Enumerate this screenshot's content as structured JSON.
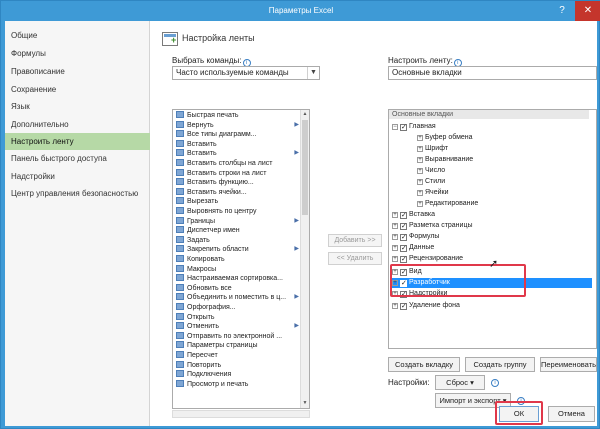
{
  "window": {
    "title": "Параметры Excel",
    "help_glyph": "?",
    "close_glyph": "✕"
  },
  "nav": {
    "items": [
      {
        "label": "Общие"
      },
      {
        "label": "Формулы"
      },
      {
        "label": "Правописание"
      },
      {
        "label": "Сохранение"
      },
      {
        "label": "Язык"
      },
      {
        "label": "Дополнительно"
      },
      {
        "label": "Настроить ленту",
        "active": true
      },
      {
        "label": "Панель быстрого доступа"
      },
      {
        "label": "Надстройки"
      },
      {
        "label": "Центр управления безопасностью"
      }
    ]
  },
  "section": {
    "title": "Настройка ленты",
    "icon": "ribbon-customize-icon"
  },
  "left": {
    "label": "Выбрать команды:",
    "select_value": "Часто используемые команды",
    "commands": [
      {
        "label": "Быстрая печать"
      },
      {
        "label": "Вернуть",
        "submenu": true
      },
      {
        "label": "Все типы диаграмм..."
      },
      {
        "label": "Вставить"
      },
      {
        "label": "Вставить",
        "submenu": true
      },
      {
        "label": "Вставить столбцы на лист"
      },
      {
        "label": "Вставить строки на лист"
      },
      {
        "label": "Вставить функцию..."
      },
      {
        "label": "Вставить ячейки..."
      },
      {
        "label": "Вырезать"
      },
      {
        "label": "Выровнять по центру"
      },
      {
        "label": "Границы",
        "submenu": true
      },
      {
        "label": "Диспетчер имен"
      },
      {
        "label": "Задать"
      },
      {
        "label": "Закрепить области",
        "submenu": true
      },
      {
        "label": "Копировать"
      },
      {
        "label": "Макросы"
      },
      {
        "label": "Настраиваемая сортировка..."
      },
      {
        "label": "Обновить все"
      },
      {
        "label": "Объединить и поместить в ц...",
        "submenu": true
      },
      {
        "label": "Орфография..."
      },
      {
        "label": "Открыть"
      },
      {
        "label": "Отменить",
        "submenu": true
      },
      {
        "label": "Отправить по электронной ..."
      },
      {
        "label": "Параметры страницы"
      },
      {
        "label": "Пересчет"
      },
      {
        "label": "Повторить"
      },
      {
        "label": "Подключения"
      },
      {
        "label": "Просмотр и печать"
      }
    ]
  },
  "middle": {
    "add_label": "Добавить >>",
    "remove_label": "<< Удалить"
  },
  "right": {
    "label": "Настроить ленту:",
    "select_value": "Основные вкладки",
    "tree_header": "Основные вкладки",
    "tree": [
      {
        "label": "Главная",
        "level": 0,
        "expander": "⊟",
        "checked": true
      },
      {
        "label": "Буфер обмена",
        "level": 1,
        "expander": "⊞"
      },
      {
        "label": "Шрифт",
        "level": 1,
        "expander": "⊞"
      },
      {
        "label": "Выравнивание",
        "level": 1,
        "expander": "⊞"
      },
      {
        "label": "Число",
        "level": 1,
        "expander": "⊞"
      },
      {
        "label": "Стили",
        "level": 1,
        "expander": "⊞"
      },
      {
        "label": "Ячейки",
        "level": 1,
        "expander": "⊞"
      },
      {
        "label": "Редактирование",
        "level": 1,
        "expander": "⊞"
      },
      {
        "label": "Вставка",
        "level": 0,
        "expander": "⊞",
        "checked": true
      },
      {
        "label": "Разметка страницы",
        "level": 0,
        "expander": "⊞",
        "checked": true
      },
      {
        "label": "Формулы",
        "level": 0,
        "expander": "⊞",
        "checked": true
      },
      {
        "label": "Данные",
        "level": 0,
        "expander": "⊞",
        "checked": true
      },
      {
        "label": "Рецензирование",
        "level": 0,
        "expander": "⊞",
        "checked": true
      },
      {
        "label": "Вид",
        "level": 0,
        "expander": "⊞",
        "checked": true
      },
      {
        "label": "Разработчик",
        "level": 0,
        "expander": "⊞",
        "checked": true,
        "selected": true
      },
      {
        "label": "Надстройки",
        "level": 0,
        "expander": "⊞",
        "checked": true
      },
      {
        "label": "Удаление фона",
        "level": 0,
        "expander": "⊞",
        "checked": true
      }
    ],
    "new_tab_label": "Создать вкладку",
    "new_group_label": "Создать группу",
    "rename_label": "Переименовать...",
    "settings_label": "Настройки:",
    "reset_label": "Сброс",
    "import_export_label": "Импорт и экспорт",
    "dropdown_glyph": "▾"
  },
  "footer": {
    "ok_label": "ОК",
    "cancel_label": "Отмена"
  },
  "colors": {
    "titlebar": "#3e9ad6",
    "nav_active": "#b6d9a6",
    "highlight": "#e0384a",
    "selection": "#1e90ff"
  }
}
